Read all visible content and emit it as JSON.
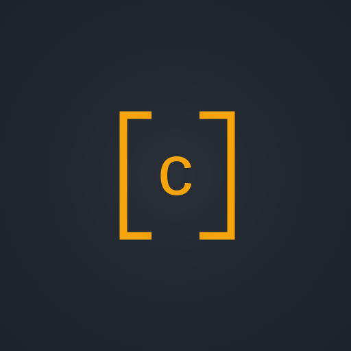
{
  "logo": {
    "letter": "c",
    "accent_color": "#f5a40c",
    "background_color": "#22272f"
  }
}
